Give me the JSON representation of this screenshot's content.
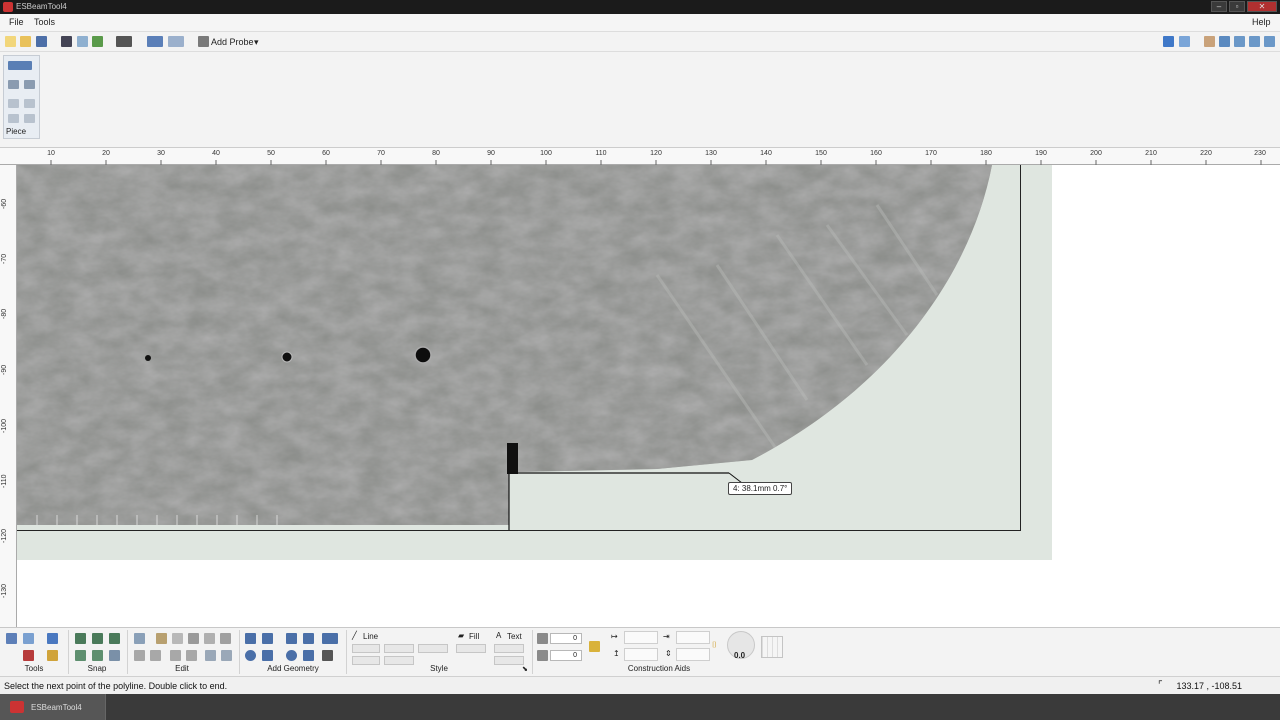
{
  "window": {
    "title": "ESBeamTool4",
    "controls": [
      "–",
      "▫",
      "✕"
    ]
  },
  "menu": {
    "left": [
      "File",
      "Tools"
    ],
    "right": "Help"
  },
  "toolbar": {
    "add_probe_label": "Add Probe"
  },
  "ribbon": {
    "piece_label": "Piece"
  },
  "rulers": {
    "horizontal": [
      "10",
      "20",
      "30",
      "40",
      "50",
      "60",
      "70",
      "80",
      "90",
      "100",
      "110",
      "120",
      "130",
      "140",
      "150",
      "160",
      "170",
      "180",
      "190",
      "200",
      "210",
      "220",
      "230"
    ],
    "vertical": [
      "-60",
      "-70",
      "-80",
      "-90",
      "-100",
      "-110",
      "-120",
      "-130"
    ]
  },
  "canvas": {
    "measurement_tip": "4:  38.1mm  0.7°"
  },
  "bottom": {
    "groups": {
      "tools": "Tools",
      "snap": "Snap",
      "edit": "Edit",
      "add_geometry": "Add Geometry",
      "style": "Style",
      "construction_aids": "Construction Aids"
    },
    "style": {
      "line_label": "Line",
      "fill_label": "Fill",
      "text_label": "Text"
    },
    "spin1": "0",
    "spin2": "0",
    "dial_value": "0.0"
  },
  "status": {
    "message": "Select the next point of the polyline. Double click to end.",
    "coords": "133.17 , -108.51"
  },
  "taskbar": {
    "item_label": "ESBeamTool4"
  }
}
